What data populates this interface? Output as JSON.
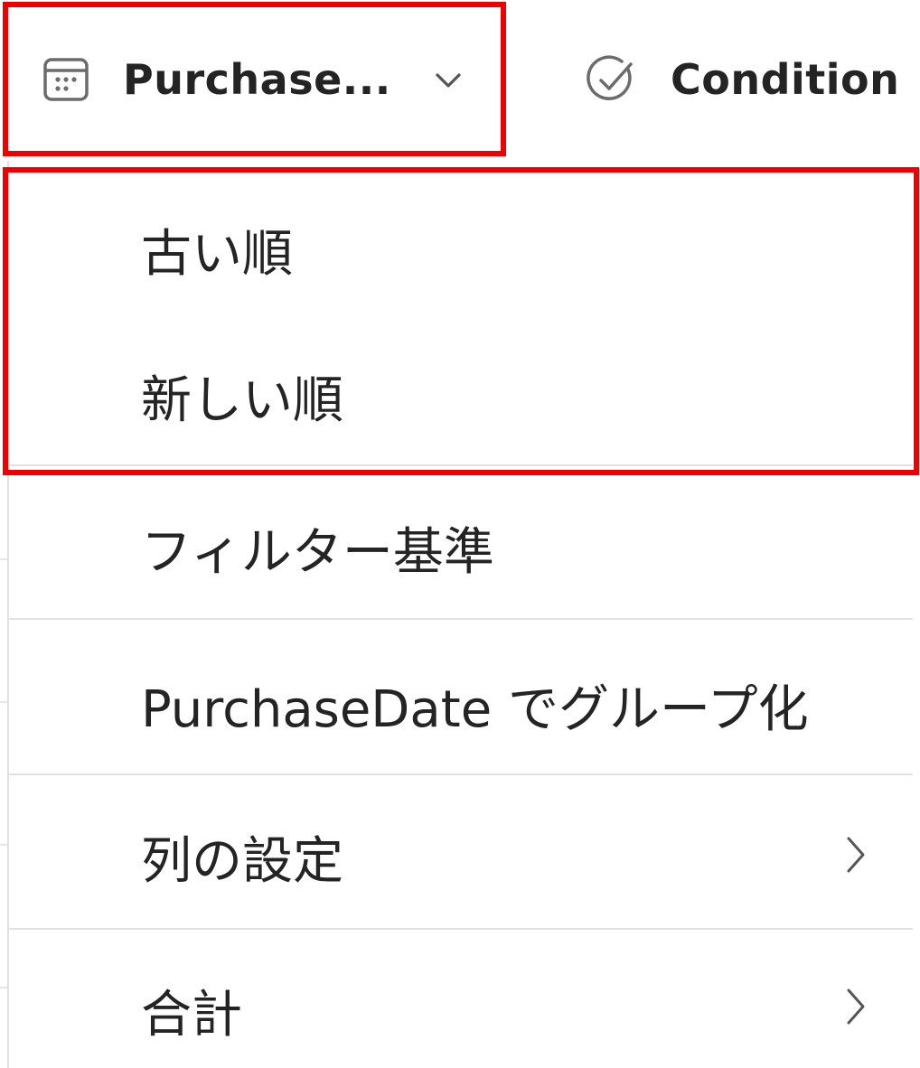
{
  "columns": {
    "purchase": {
      "label": "Purchase...",
      "icon": "calendar-icon"
    },
    "condition": {
      "label": "Condition",
      "icon": "check-circle-icon"
    }
  },
  "menu": {
    "sort_items": [
      {
        "label": "古い順"
      },
      {
        "label": "新しい順"
      }
    ],
    "items": [
      {
        "label": "フィルター基準",
        "has_submenu": false
      },
      {
        "label": "PurchaseDate でグループ化",
        "has_submenu": false
      },
      {
        "label": "列の設定",
        "has_submenu": true
      },
      {
        "label": "合計",
        "has_submenu": true
      }
    ]
  },
  "colors": {
    "highlight": "#f00000",
    "text": "#242424",
    "divider": "#e1e1e1",
    "icon": "#6b6b6b"
  }
}
